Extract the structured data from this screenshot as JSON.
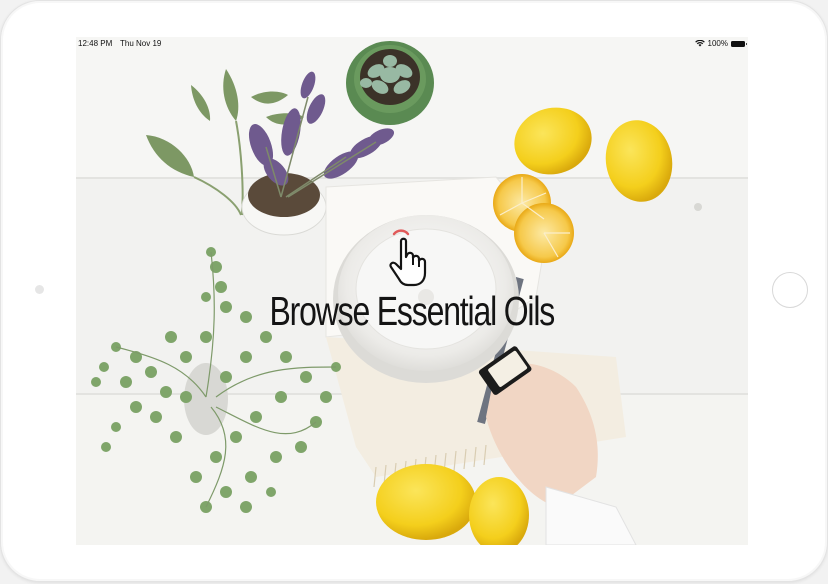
{
  "status_bar": {
    "time": "12:48 PM",
    "date": "Thu Nov 19",
    "battery": "100%",
    "wifi_icon": "wifi-icon",
    "battery_icon": "battery-icon"
  },
  "screen": {
    "headline": "Browse Essential Oils",
    "tap_icon": "tap-hand-icon",
    "background_image": "essential-oils-flatlay-photo"
  },
  "colors": {
    "lemon": "#f4cf1c",
    "lavender": "#6f5a8e",
    "leaf": "#6f9a5e",
    "diffuser": "#f0f0ee",
    "headline": "#141414",
    "tap_accent": "#e05a5a"
  }
}
